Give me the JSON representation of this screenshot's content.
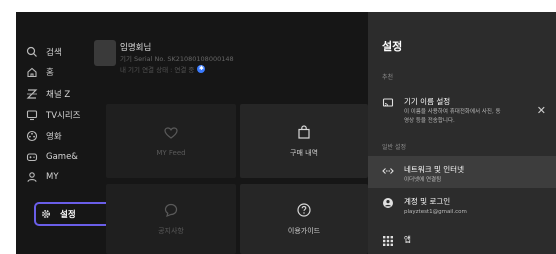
{
  "sidebar": {
    "items": [
      {
        "label": "검색",
        "icon": "search-icon"
      },
      {
        "label": "홈",
        "icon": "home-icon"
      },
      {
        "label": "채널 Z",
        "icon": "channel-icon"
      },
      {
        "label": "TV시리즈",
        "icon": "tv-icon"
      },
      {
        "label": "영화",
        "icon": "movie-icon"
      },
      {
        "label": "Game&",
        "icon": "game-icon"
      },
      {
        "label": "MY",
        "icon": "user-icon"
      },
      {
        "label": "설정",
        "icon": "gear-icon",
        "active": true
      }
    ]
  },
  "profile": {
    "name": "임명회님",
    "serial": "기기 Serial No. SK21080108000148",
    "status": "내 기기 연결 상태 : 연결 중"
  },
  "tiles": [
    {
      "label": "MY Feed",
      "icon": "heart-icon"
    },
    {
      "label": "구매 내역",
      "icon": "shopping-bag-icon"
    },
    {
      "label": "공지사항",
      "icon": "chat-icon"
    },
    {
      "label": "이용가이드",
      "icon": "help-icon"
    }
  ],
  "panel": {
    "title": "설정",
    "recommended_label": "추천",
    "recommended": {
      "title": "기기 이름 설정",
      "subtitle_line1": "이 이름을 사용하여 휴대전화에서 사진, 동",
      "subtitle_line2": "영상 등을 전송합니다.",
      "close": "✕"
    },
    "general_label": "일반 설정",
    "items": [
      {
        "title": "네트워크 및 인터넷",
        "subtitle": "이더넷에 연결됨",
        "icon": "network-icon",
        "selected": true
      },
      {
        "title": "계정 및 로그인",
        "subtitle": "playztest1@gmail.com",
        "icon": "account-icon"
      },
      {
        "title": "앱",
        "subtitle": "",
        "icon": "apps-icon"
      }
    ]
  },
  "colors": {
    "accent": "#6a5ee8",
    "status_dot": "#3a7bff"
  }
}
